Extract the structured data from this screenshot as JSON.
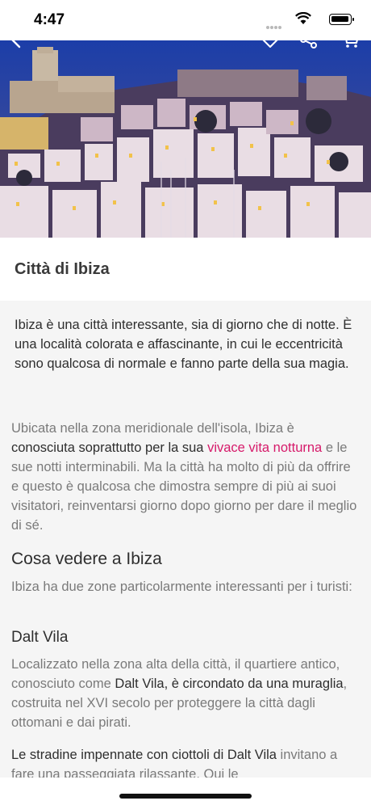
{
  "status": {
    "time": "4:47"
  },
  "place": {
    "title": "Città di Ibiza"
  },
  "intro": "Ibiza è una città interessante, sia di giorno che di notte. È una località colorata e affascinante, in cui le eccentricità sono qualcosa di normale e fanno parte della sua magia.",
  "p1": {
    "a": "Ubicata nella zona meridionale dell'isola, Ibiza è ",
    "b": "conosciuta soprattutto per la sua ",
    "link": "vivace vita notturna",
    "c": " e le sue notti interminabili. Ma la città ha molto di più da offrire e questo è qualcosa che dimostra sempre di più ai suoi visitatori, reinventarsi giorno dopo giorno per dare il meglio di sé."
  },
  "section_heading": "Cosa vedere a Ibiza",
  "p2": "Ibiza ha due zone particolarmente interessanti per i turisti:",
  "sub_heading": "Dalt Vila",
  "p3": {
    "a": "Localizzato nella zona alta della città, il quartiere antico, conosciuto come ",
    "b": "Dalt Vila",
    "c": ", è circondato da una muraglia",
    "d": ", costruita nel XVI secolo per proteggere la città dagli ottomani e dai pirati."
  },
  "p4": {
    "a": "Le stradine impennate con ciottoli di Dalt Vila",
    "b": " invitano a fare una passeggiata rilassante. Qui le"
  }
}
